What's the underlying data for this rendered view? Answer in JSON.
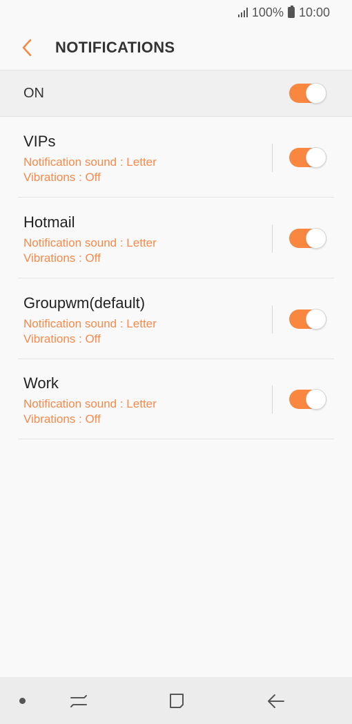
{
  "status_bar": {
    "battery": "100%",
    "time": "10:00"
  },
  "header": {
    "title": "NOTIFICATIONS"
  },
  "master": {
    "label": "ON",
    "enabled": true
  },
  "accounts": [
    {
      "name": "VIPs",
      "sound": "Notification sound : Letter",
      "vibrations": "Vibrations : Off",
      "enabled": true
    },
    {
      "name": "Hotmail",
      "sound": "Notification sound : Letter",
      "vibrations": "Vibrations : Off",
      "enabled": true
    },
    {
      "name": "Groupwm(default)",
      "sound": "Notification sound : Letter",
      "vibrations": "Vibrations : Off",
      "enabled": true
    },
    {
      "name": "Work",
      "sound": "Notification sound : Letter",
      "vibrations": "Vibrations : Off",
      "enabled": true
    }
  ],
  "nav_bar": {
    "icons": [
      "dot-icon",
      "recent-apps-icon",
      "home-icon",
      "back-icon"
    ]
  },
  "colors": {
    "accent": "#f9873f",
    "subtext": "#f7894a"
  }
}
